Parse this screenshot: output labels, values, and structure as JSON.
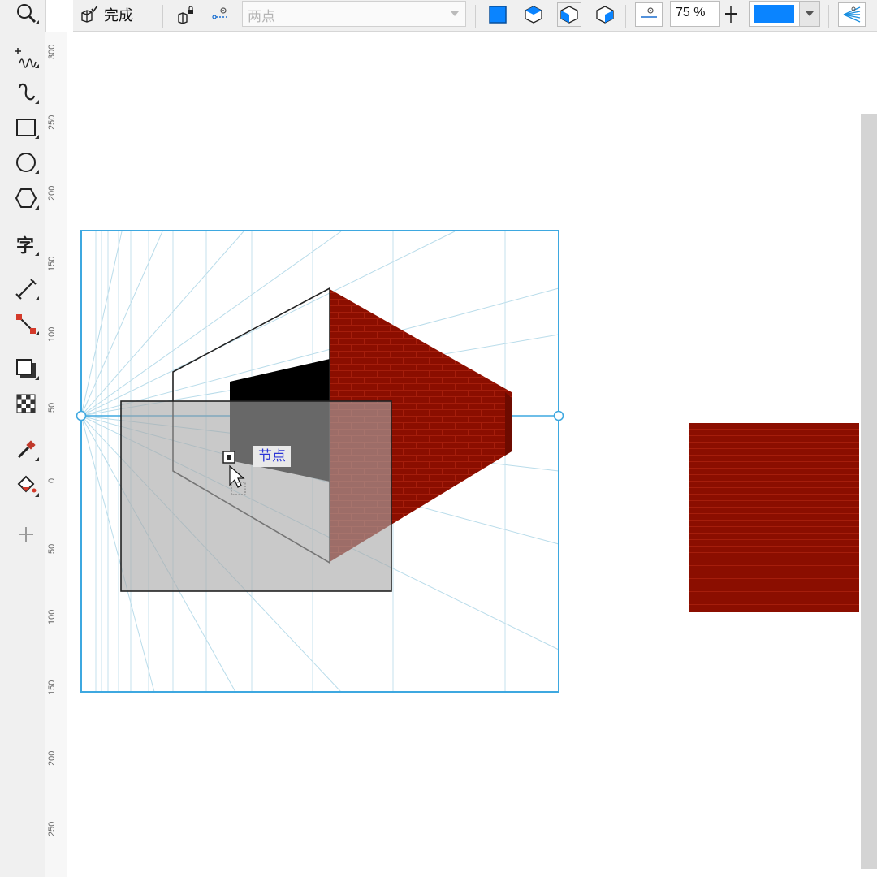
{
  "propbar": {
    "done_label": "完成",
    "mode_value": "两点",
    "zoom_value": "75 %",
    "fill_color": "#0a84ff"
  },
  "ruler": {
    "labels": [
      "300",
      "250",
      "200",
      "150",
      "100",
      "50",
      "0",
      "50",
      "100",
      "150",
      "200",
      "250"
    ]
  },
  "tools": [
    "zoom-icon",
    "freehand-icon",
    "bezier-icon",
    "rectangle-icon",
    "ellipse-icon",
    "polygon-icon",
    "text-icon",
    "dimension-icon",
    "connector-icon",
    "drop-shadow-icon",
    "transparency-icon",
    "eyedropper-icon",
    "interactive-fill-icon",
    "add-tool-icon"
  ],
  "canvas": {
    "tooltip": "节点",
    "colors": {
      "brick": "#8b0e00",
      "guide": "#9fd0e2",
      "frame": "#3ea8e0",
      "gray": "#c8c8c8"
    }
  }
}
